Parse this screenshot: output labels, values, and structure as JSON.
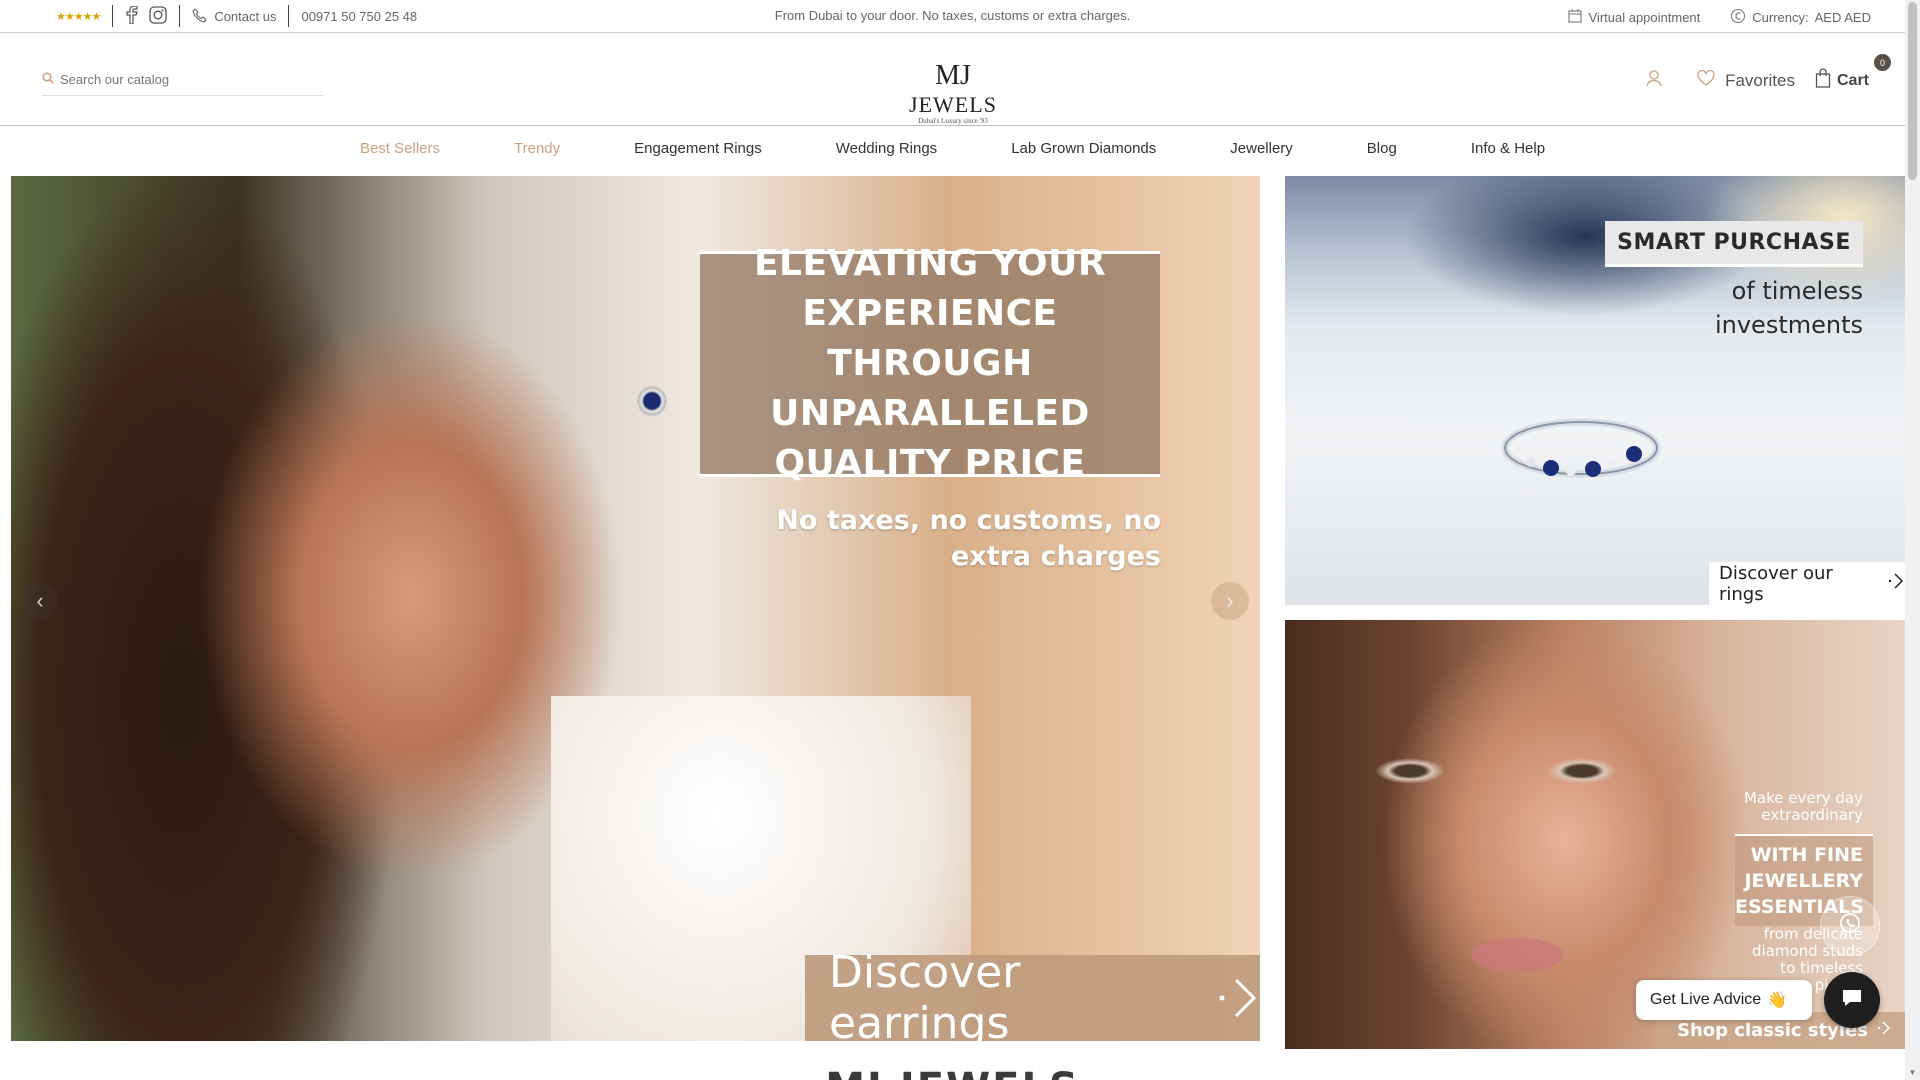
{
  "topbar": {
    "rating_stars": "★★★★★",
    "contact_label": "Contact us",
    "phone": "00971 50 750 25 48",
    "announcement": "From Dubai to your door. No taxes, customs or extra charges.",
    "virtual_appointment": "Virtual appointment",
    "currency_label": "Currency:",
    "currency_value": "AED AED"
  },
  "header": {
    "search_placeholder": "Search our catalog",
    "logo_main_left": "MJ",
    "logo_main_right": "JEWELS",
    "logo_tagline": "Dubai's Luxury since '93",
    "favorites": "Favorites",
    "cart": "Cart",
    "cart_count": "0"
  },
  "nav": {
    "items": [
      {
        "label": "Best Sellers"
      },
      {
        "label": "Trendy"
      },
      {
        "label": "Engagement Rings"
      },
      {
        "label": "Wedding Rings"
      },
      {
        "label": "Lab Grown Diamonds"
      },
      {
        "label": "Jewellery"
      },
      {
        "label": "Blog"
      },
      {
        "label": "Info & Help"
      }
    ]
  },
  "hero": {
    "title": "ELEVATING YOUR EXPERIENCE THROUGH UNPARALLELED QUALITY PRICE",
    "subtitle": "No taxes, no customs, no extra charges",
    "cta": "Discover earrings"
  },
  "banner_rings": {
    "badge": "SMART PURCHASE",
    "sub_line1": "of timeless",
    "sub_line2": "investments",
    "cta": "Discover our rings"
  },
  "banner_classic": {
    "small_line1": "Make every day",
    "small_line2": "extraordinary",
    "big_line1": "WITH FINE",
    "big_line2": "JEWELLERY",
    "big_line3": "ESSENTIALS",
    "desc_line1": "from delicate",
    "desc_line2": "diamond studs",
    "desc_line3": "to timeless",
    "desc_line4": "pieces",
    "cta": "Shop classic styles"
  },
  "widgets": {
    "live_advice": "Get Live Advice",
    "wave_emoji": "👋"
  },
  "section": {
    "title": "MJ JEWELS"
  },
  "colors": {
    "accent": "#c8a27c",
    "dark": "#1f1f1f"
  }
}
